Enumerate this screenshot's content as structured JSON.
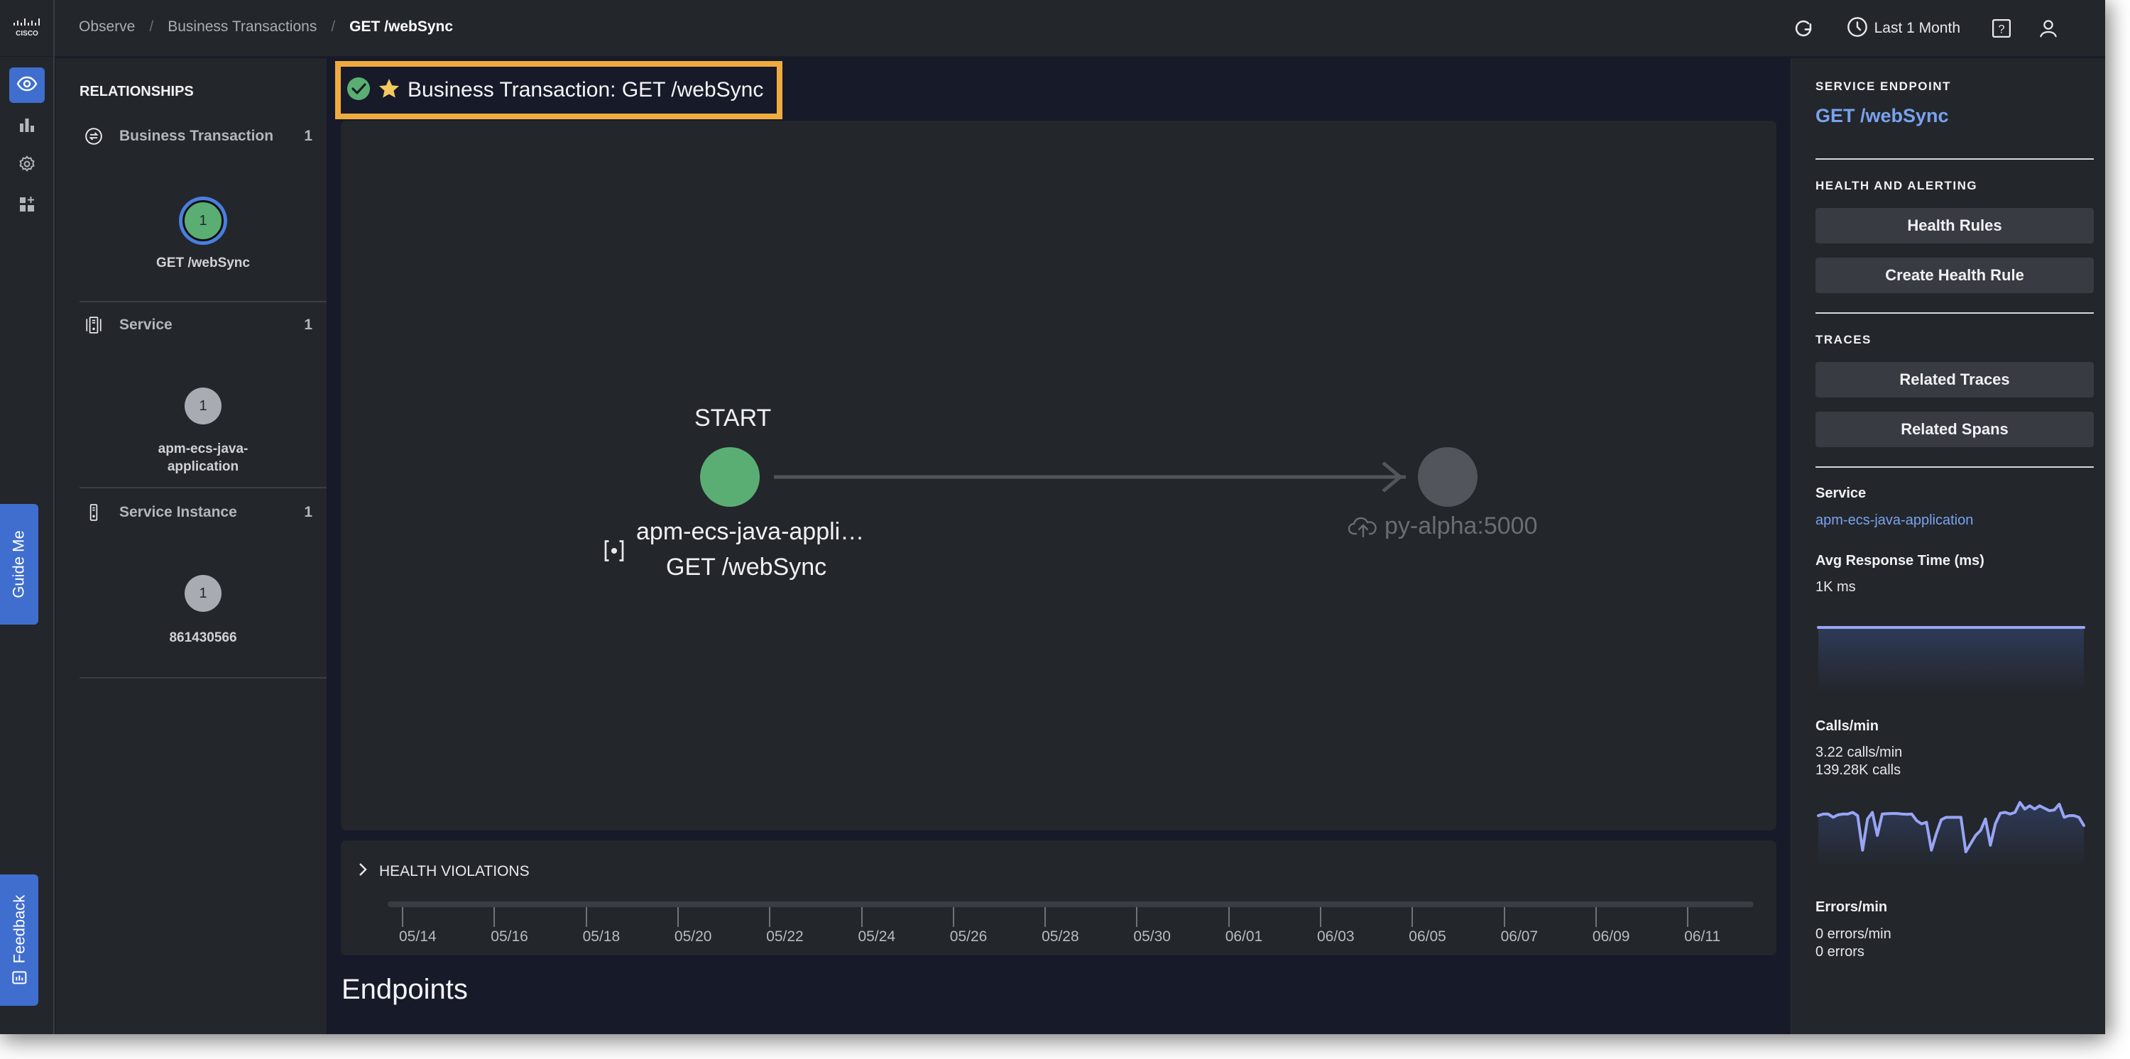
{
  "header": {
    "logo": "cisco-logo",
    "breadcrumb": [
      "Observe",
      "Business Transactions",
      "GET /webSync"
    ],
    "time_range": "Last 1 Month",
    "icons": [
      "refresh-icon",
      "clock-icon",
      "help-icon",
      "user-icon"
    ]
  },
  "rail": {
    "items": [
      {
        "icon": "eye-icon",
        "active": true
      },
      {
        "icon": "bar-chart-icon",
        "active": false
      },
      {
        "icon": "gear-icon",
        "active": false
      },
      {
        "icon": "add-widget-icon",
        "active": false
      }
    ],
    "guide_me": "Guide Me",
    "feedback": "Feedback"
  },
  "relationships": {
    "title": "RELATIONSHIPS",
    "sections": [
      {
        "name": "Business Transaction",
        "count": "1",
        "node_count": "1",
        "node_label": "GET /webSync",
        "status": "healthy"
      },
      {
        "name": "Service",
        "count": "1",
        "node_count": "1",
        "node_label": "apm-ecs-java-application",
        "status": "unknown"
      },
      {
        "name": "Service Instance",
        "count": "1",
        "node_count": "1",
        "node_label": "861430566",
        "status": "unknown"
      }
    ]
  },
  "main": {
    "title": "Business Transaction: GET /webSync",
    "flow": {
      "start_label": "START",
      "source_name": "apm-ecs-java-appli…",
      "source_endpoint": "GET /webSync",
      "target_name": "py-alpha:5000"
    },
    "health_violations": {
      "title": "HEALTH VIOLATIONS",
      "ticks": [
        "05/14",
        "05/16",
        "05/18",
        "05/20",
        "05/22",
        "05/24",
        "05/26",
        "05/28",
        "05/30",
        "06/01",
        "06/03",
        "06/05",
        "06/07",
        "06/09",
        "06/11"
      ]
    },
    "endpoints_heading": "Endpoints"
  },
  "right_panel": {
    "service_endpoint_title": "SERVICE ENDPOINT",
    "service_endpoint_name": "GET /webSync",
    "health_title": "HEALTH AND ALERTING",
    "health_rules_btn": "Health Rules",
    "create_health_rule_btn": "Create Health Rule",
    "traces_title": "TRACES",
    "related_traces_btn": "Related Traces",
    "related_spans_btn": "Related Spans",
    "service_label": "Service",
    "service_link": "apm-ecs-java-application",
    "avg_rt_label": "Avg Response Time (ms)",
    "avg_rt_value": "1K ms",
    "calls_label": "Calls/min",
    "calls_rate": "3.22 calls/min",
    "calls_total": "139.28K calls",
    "errors_label": "Errors/min",
    "errors_rate": "0 errors/min",
    "errors_total": "0 errors",
    "line_color": "#98a4f5",
    "avg_rt_series": [
      1,
      1,
      1,
      1,
      1,
      1,
      1,
      1,
      1,
      1
    ],
    "calls_series": [
      3.3,
      3.4,
      3.4,
      3.2,
      3.35,
      3.4,
      3.4,
      3.5,
      3.3,
      1.2,
      3.1,
      3.5,
      2.1,
      3.4,
      3.42,
      3.43,
      3.43,
      3.4,
      3.38,
      3.4,
      3.0,
      2.8,
      2.9,
      1.2,
      2.2,
      3.05,
      3.2,
      3.2,
      3.2,
      3.2,
      1.1,
      1.6,
      2.1,
      2.4,
      3.1,
      1.5,
      2.8,
      3.45,
      3.5,
      3.4,
      3.5,
      4.1,
      3.7,
      3.9,
      3.7,
      3.9,
      3.75,
      3.6,
      3.65,
      4.0,
      3.2,
      3.3,
      3.3,
      3.2,
      2.7
    ]
  }
}
